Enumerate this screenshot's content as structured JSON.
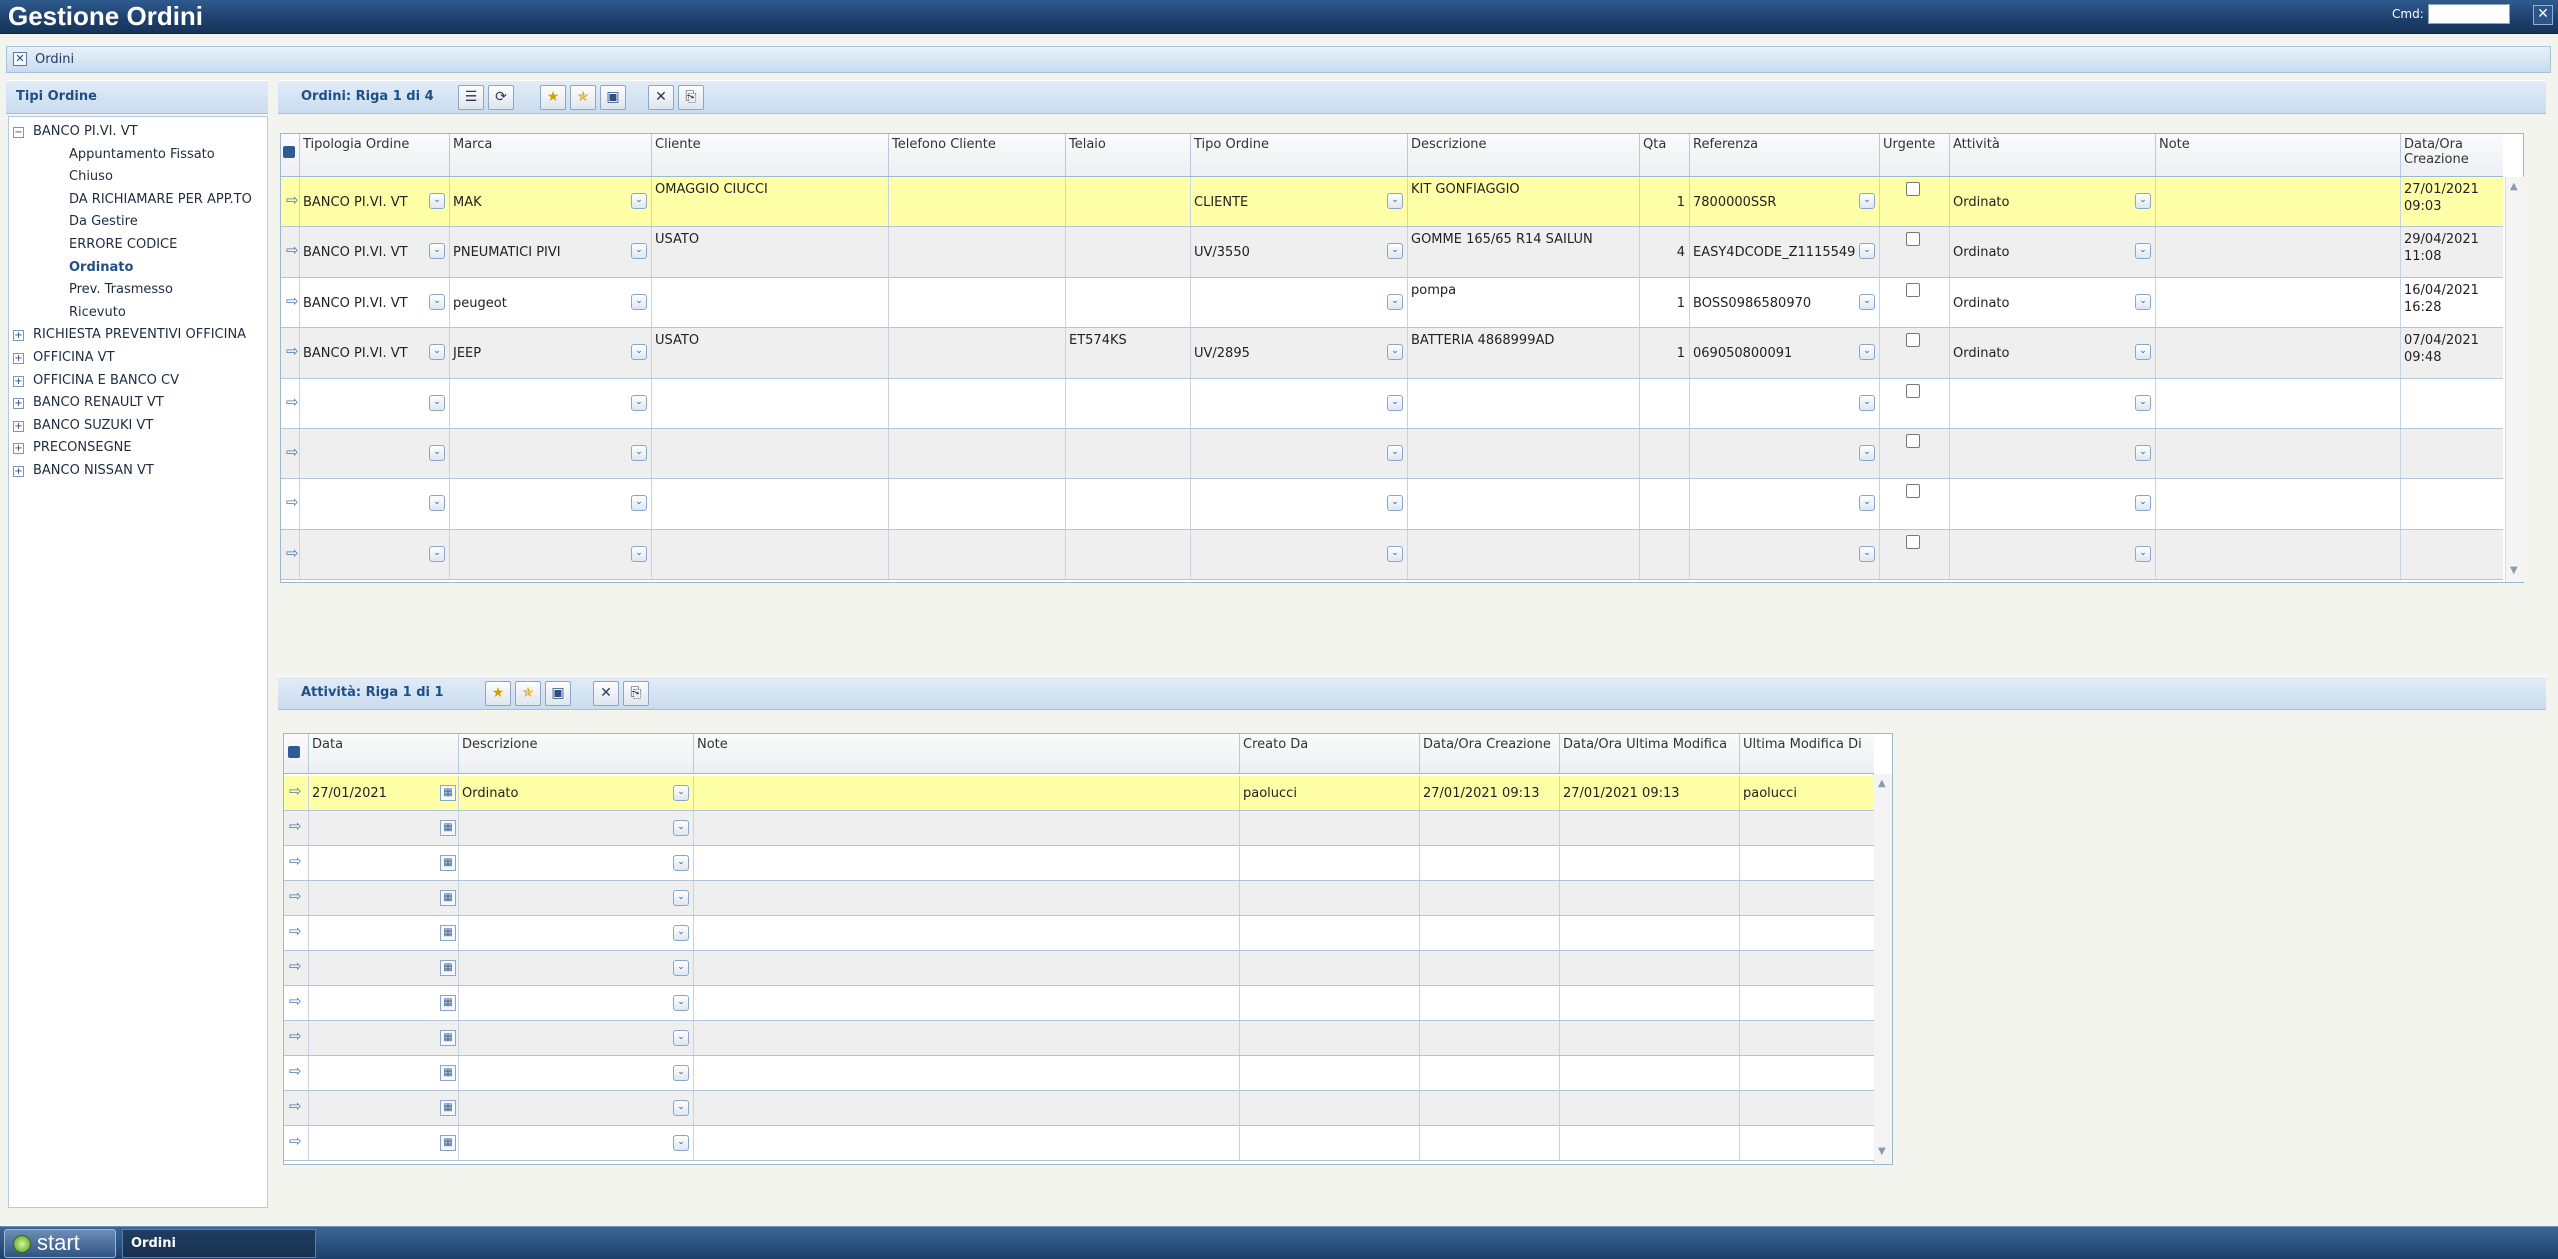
{
  "app": {
    "title": "Gestione Ordini",
    "cmd_label": "Cmd:",
    "close_glyph": "✕"
  },
  "tab": {
    "label": "Ordini",
    "close_glyph": "✕"
  },
  "left_panel": {
    "title": "Tipi Ordine"
  },
  "tree": [
    {
      "label": "BANCO PI.VI. VT",
      "level": 0,
      "expander": "−"
    },
    {
      "label": "Appuntamento Fissato",
      "level": 1
    },
    {
      "label": "Chiuso",
      "level": 1
    },
    {
      "label": "DA RICHIAMARE PER APP.TO",
      "level": 1
    },
    {
      "label": "Da Gestire",
      "level": 1
    },
    {
      "label": "ERRORE CODICE",
      "level": 1
    },
    {
      "label": "Ordinato",
      "level": 1,
      "selected": true
    },
    {
      "label": "Prev. Trasmesso",
      "level": 1
    },
    {
      "label": "Ricevuto",
      "level": 1
    },
    {
      "label": "RICHIESTA PREVENTIVI OFFICINA",
      "level": 0,
      "expander": "+"
    },
    {
      "label": "OFFICINA VT",
      "level": 0,
      "expander": "+"
    },
    {
      "label": "OFFICINA E BANCO CV",
      "level": 0,
      "expander": "+"
    },
    {
      "label": "BANCO RENAULT VT",
      "level": 0,
      "expander": "+"
    },
    {
      "label": "BANCO SUZUKI VT",
      "level": 0,
      "expander": "+"
    },
    {
      "label": "PRECONSEGNE",
      "level": 0,
      "expander": "+"
    },
    {
      "label": "BANCO NISSAN VT",
      "level": 0,
      "expander": "+"
    }
  ],
  "orders": {
    "header": "Ordini: Riga 1 di 4",
    "columns": [
      "Tipologia Ordine",
      "Marca",
      "Cliente",
      "Telefono Cliente",
      "Telaio",
      "Tipo Ordine",
      "Descrizione",
      "Qta",
      "Referenza",
      "Urgente",
      "Attività",
      "Note",
      "Data/Ora Creazione"
    ],
    "rows": [
      {
        "tipologia": "BANCO PI.VI. VT",
        "marca": "MAK",
        "cliente": "OMAGGIO CIUCCI",
        "telefono": "",
        "telaio": "",
        "tipo": "CLIENTE",
        "descrizione": "KIT GONFIAGGIO",
        "qta": "1",
        "referenza": "7800000SSR",
        "urgente": false,
        "attivita": "Ordinato",
        "note": "",
        "data1": "27/01/2021",
        "data2": "09:03"
      },
      {
        "tipologia": "BANCO PI.VI. VT",
        "marca": "PNEUMATICI PIVI",
        "cliente": "USATO",
        "telefono": "",
        "telaio": "",
        "tipo": "UV/3550",
        "descrizione": "GOMME 165/65 R14 SAILUN",
        "qta": "4",
        "referenza": "EASY4DCODE_Z1115549",
        "urgente": false,
        "attivita": "Ordinato",
        "note": "",
        "data1": "29/04/2021",
        "data2": "11:08"
      },
      {
        "tipologia": "BANCO PI.VI. VT",
        "marca": "peugeot",
        "cliente": "",
        "telefono": "",
        "telaio": "",
        "tipo": "",
        "descrizione": "pompa",
        "qta": "1",
        "referenza": "BOSS0986580970",
        "urgente": false,
        "attivita": "Ordinato",
        "note": "",
        "data1": "16/04/2021",
        "data2": "16:28"
      },
      {
        "tipologia": "BANCO PI.VI. VT",
        "marca": "JEEP",
        "cliente": "USATO",
        "telefono": "",
        "telaio": "ET574KS",
        "tipo": "UV/2895",
        "descrizione": "BATTERIA 4868999AD",
        "qta": "1",
        "referenza": "069050800091",
        "urgente": false,
        "attivita": "Ordinato",
        "note": "",
        "data1": "07/04/2021",
        "data2": "09:48"
      }
    ],
    "empty_rows": 4
  },
  "activities": {
    "header": "Attività: Riga 1 di 1",
    "columns": [
      "Data",
      "Descrizione",
      "Note",
      "Creato Da",
      "Data/Ora Creazione",
      "Data/Ora Ultima Modifica",
      "Ultima Modifica Di"
    ],
    "rows": [
      {
        "data": "27/01/2021",
        "descrizione": "Ordinato",
        "note": "",
        "creato": "paolucci",
        "creazione": "27/01/2021 09:13",
        "modifica": "27/01/2021 09:13",
        "modificato_di": "paolucci"
      }
    ],
    "empty_rows": 10
  },
  "taskbar": {
    "start_label": "start",
    "item_label": "Ordini"
  },
  "icons": {
    "row_arrow": "⇨",
    "dropdown": "⌄",
    "calendar": "▦",
    "scroll_up": "▲",
    "scroll_down": "▼",
    "expand": "+",
    "collapse": "−"
  },
  "colors": {
    "titlebar": "#1d3f6b",
    "selected_row": "#ffffa8",
    "alt_row": "#efefef",
    "header_text": "#1f4f86"
  }
}
